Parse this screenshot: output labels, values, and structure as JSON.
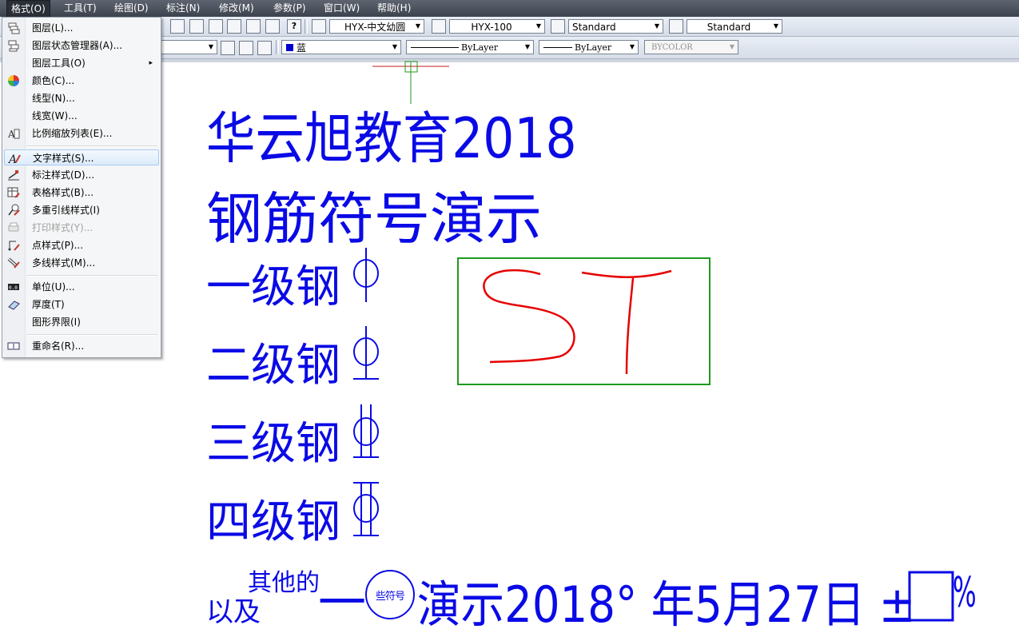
{
  "menubar": {
    "items": [
      "格式(O)",
      "工具(T)",
      "绘图(D)",
      "标注(N)",
      "修改(M)",
      "参数(P)",
      "窗口(W)",
      "帮助(H)"
    ]
  },
  "toolbar1": {
    "text_style": "HYX-中文幼圆",
    "dim_style": "HYX-100",
    "table_style": "Standard",
    "mleader_style": "Standard"
  },
  "toolbar2": {
    "color": "蓝",
    "linetype": "ByLayer",
    "lineweight": "ByLayer",
    "plotstyle": "BYCOLOR"
  },
  "format_menu": {
    "items": [
      {
        "label": "图层(L)...",
        "icon": "layer-icon"
      },
      {
        "label": "图层状态管理器(A)...",
        "icon": "layer-state-icon"
      },
      {
        "label": "图层工具(O)",
        "icon": "",
        "submenu": "▸"
      },
      {
        "label": "颜色(C)...",
        "icon": "color-wheel-icon"
      },
      {
        "label": "线型(N)...",
        "icon": ""
      },
      {
        "label": "线宽(W)...",
        "icon": ""
      },
      {
        "label": "比例缩放列表(E)...",
        "icon": "scale-list-icon"
      },
      {
        "label": "文字样式(S)...",
        "icon": "text-style-icon"
      },
      {
        "label": "标注样式(D)...",
        "icon": "dim-style-icon"
      },
      {
        "label": "表格样式(B)...",
        "icon": "table-style-icon"
      },
      {
        "label": "多重引线样式(I)",
        "icon": "mleader-style-icon"
      },
      {
        "label": "打印样式(Y)...",
        "icon": "plot-style-icon"
      },
      {
        "label": "点样式(P)...",
        "icon": "point-style-icon"
      },
      {
        "label": "多线样式(M)...",
        "icon": "mline-style-icon"
      },
      {
        "label": "单位(U)...",
        "icon": "units-icon"
      },
      {
        "label": "厚度(T)",
        "icon": "thickness-icon"
      },
      {
        "label": "图形界限(I)",
        "icon": ""
      },
      {
        "label": "重命名(R)...",
        "icon": "rename-icon"
      }
    ]
  },
  "drawing": {
    "line1": "华云旭教育2018",
    "line2": "钢筋符号演示",
    "grade1": "一级钢",
    "grade2": "二级钢",
    "grade3": "三级钢",
    "grade4": "四级钢",
    "bottom_yiji": "以及",
    "bottom_sup": "其他的",
    "bottom_dash": "一",
    "bottom_circle": "些符号",
    "bottom_rest": "演示2018° 年5月27日 ±",
    "bottom_pct": "%",
    "sketch_letters": "ST",
    "colors": {
      "text": "#0a0ae6",
      "frame": "#1f9a1f",
      "sketch": "#e60000"
    }
  }
}
